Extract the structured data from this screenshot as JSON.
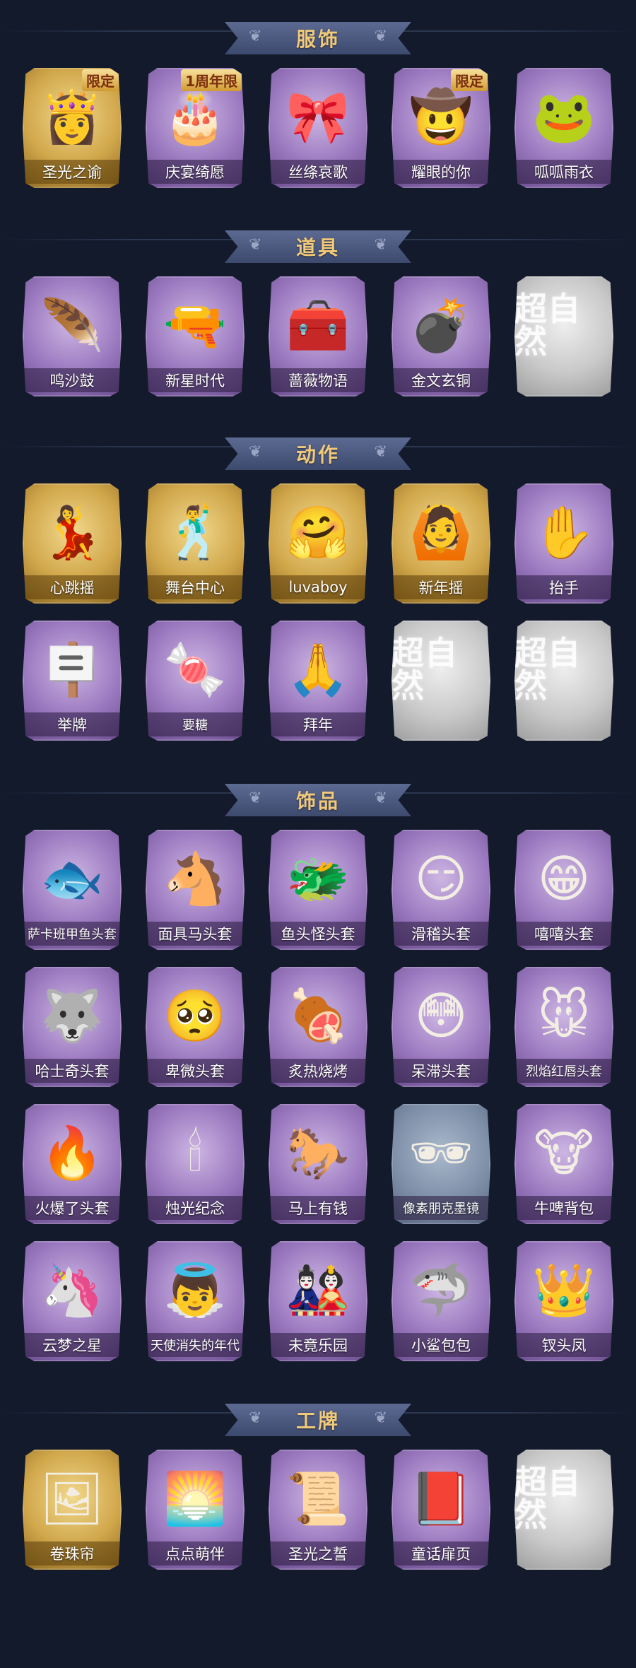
{
  "sections": [
    {
      "title": "服饰",
      "items": [
        {
          "label": "圣光之谕",
          "badge": "限定",
          "tier": "gold",
          "icon": "golden-haired-doll-icon"
        },
        {
          "label": "庆宴绮愿",
          "badge": "1周年限",
          "tier": "purple",
          "icon": "cake-doll-icon"
        },
        {
          "label": "丝绦哀歌",
          "badge": "",
          "tier": "purple",
          "icon": "gothic-doll-icon"
        },
        {
          "label": "耀眼的你",
          "badge": "限定",
          "tier": "purple",
          "icon": "cowboy-hat-doll-icon"
        },
        {
          "label": "呱呱雨衣",
          "badge": "",
          "tier": "purple",
          "icon": "frog-hat-doll-icon"
        }
      ]
    },
    {
      "title": "道具",
      "items": [
        {
          "label": "鸣沙鼓",
          "tier": "purple",
          "icon": "dreamcatcher-icon"
        },
        {
          "label": "新星时代",
          "tier": "purple",
          "icon": "revolver-icon"
        },
        {
          "label": "蔷薇物语",
          "tier": "purple",
          "icon": "medkit-icon"
        },
        {
          "label": "金文玄铜",
          "tier": "purple",
          "icon": "grenade-icon"
        },
        {
          "label": "",
          "tier": "silver",
          "icon": "placeholder-logo-icon"
        }
      ]
    },
    {
      "title": "动作",
      "items": [
        {
          "label": "心跳摇",
          "tier": "gold",
          "icon": "dance-pose-icon"
        },
        {
          "label": "舞台中心",
          "tier": "gold",
          "icon": "stage-pose-icon"
        },
        {
          "label": "luvaboy",
          "tier": "gold",
          "icon": "hug-pose-icon"
        },
        {
          "label": "新年摇",
          "tier": "gold",
          "icon": "new-year-pose-icon"
        },
        {
          "label": "抬手",
          "tier": "purple",
          "icon": "raise-hand-pose-icon"
        },
        {
          "label": "举牌",
          "tier": "purple",
          "icon": "sign-pose-icon"
        },
        {
          "label": "要糖",
          "tier": "purple",
          "icon": "candy-pose-icon",
          "small": true
        },
        {
          "label": "拜年",
          "tier": "purple",
          "icon": "greeting-pose-icon"
        },
        {
          "label": "",
          "tier": "silver",
          "icon": "placeholder-logo-icon"
        },
        {
          "label": "",
          "tier": "silver",
          "icon": "placeholder-logo-icon"
        }
      ]
    },
    {
      "title": "饰品",
      "items": [
        {
          "label": "萨卡班甲鱼头套",
          "tier": "purple",
          "icon": "fish-head-icon",
          "small": true
        },
        {
          "label": "面具马头套",
          "tier": "purple",
          "icon": "horse-head-icon"
        },
        {
          "label": "鱼头怪头套",
          "tier": "purple",
          "icon": "fish-monster-head-icon"
        },
        {
          "label": "滑稽头套",
          "tier": "purple",
          "icon": "funny-face-icon"
        },
        {
          "label": "嘻嘻头套",
          "tier": "purple",
          "icon": "grin-face-icon"
        },
        {
          "label": "哈士奇头套",
          "tier": "purple",
          "icon": "husky-head-icon"
        },
        {
          "label": "卑微头套",
          "tier": "purple",
          "icon": "humble-face-icon"
        },
        {
          "label": "炙热烧烤",
          "tier": "purple",
          "icon": "bbq-meat-icon"
        },
        {
          "label": "呆滞头套",
          "tier": "purple",
          "icon": "dazed-face-icon"
        },
        {
          "label": "烈焰红唇头套",
          "tier": "purple",
          "icon": "pikachu-head-icon",
          "small": true
        },
        {
          "label": "火爆了头套",
          "tier": "purple",
          "icon": "fire-spirit-icon"
        },
        {
          "label": "烛光纪念",
          "tier": "purple",
          "icon": "candle-icon"
        },
        {
          "label": "马上有钱",
          "tier": "purple",
          "icon": "red-horse-icon"
        },
        {
          "label": "像素朋克墨镜",
          "tier": "blue",
          "icon": "pixel-sunglasses-icon",
          "small": true
        },
        {
          "label": "牛啤背包",
          "tier": "purple",
          "icon": "cow-beer-backpack-icon"
        },
        {
          "label": "云梦之星",
          "tier": "purple",
          "icon": "unicorn-icon"
        },
        {
          "label": "天使消失的年代",
          "tier": "purple",
          "icon": "angel-doll-icon",
          "small": true
        },
        {
          "label": "未竟乐园",
          "tier": "purple",
          "icon": "pink-doll-icon"
        },
        {
          "label": "小鲨包包",
          "tier": "purple",
          "icon": "shark-bag-icon"
        },
        {
          "label": "钗头凤",
          "tier": "purple",
          "icon": "phoenix-crown-icon"
        }
      ]
    },
    {
      "title": "工牌",
      "items": [
        {
          "label": "卷珠帘",
          "tier": "gold",
          "icon": "card-frame-icon"
        },
        {
          "label": "点点萌伴",
          "tier": "purple",
          "icon": "sunny-card-icon"
        },
        {
          "label": "圣光之誓",
          "tier": "purple",
          "icon": "holy-card-icon"
        },
        {
          "label": "童话扉页",
          "tier": "purple",
          "icon": "storybook-card-icon"
        },
        {
          "label": "",
          "tier": "silver",
          "icon": "placeholder-logo-icon"
        }
      ]
    }
  ],
  "placeholder_text": "超自然"
}
